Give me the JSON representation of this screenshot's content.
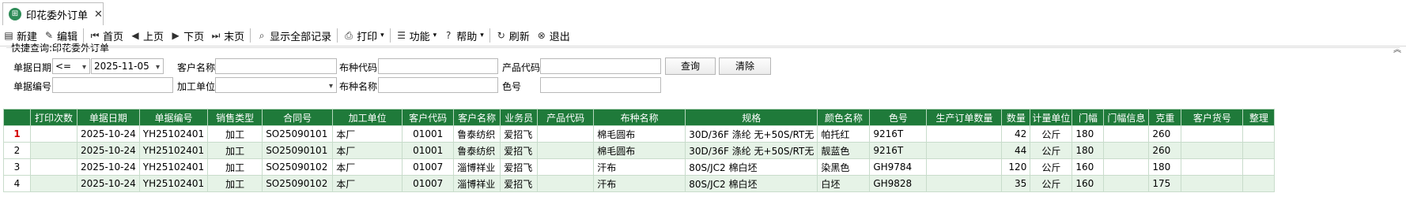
{
  "tab": {
    "label": "印花委外订单",
    "close": "✕"
  },
  "toolbar": [
    {
      "name": "new-button",
      "icon": "new-doc-icon",
      "glyph": "▤",
      "label": "新建"
    },
    {
      "name": "edit-button",
      "icon": "edit-icon",
      "glyph": "✎",
      "label": "编辑"
    },
    {
      "name": "first-page-button",
      "icon": "first-page-icon",
      "glyph": "⏮",
      "label": "首页"
    },
    {
      "name": "prev-page-button",
      "icon": "prev-page-icon",
      "glyph": "◀",
      "label": "上页"
    },
    {
      "name": "next-page-button",
      "icon": "next-page-icon",
      "glyph": "▶",
      "label": "下页"
    },
    {
      "name": "last-page-button",
      "icon": "last-page-icon",
      "glyph": "⏭",
      "label": "末页"
    },
    {
      "name": "show-all-button",
      "icon": "search-doc-icon",
      "glyph": "⌕",
      "label": "显示全部记录"
    },
    {
      "name": "print-button",
      "icon": "printer-icon",
      "glyph": "⎙",
      "label": "打印",
      "caret": "▾"
    },
    {
      "name": "function-button",
      "icon": "list-icon",
      "glyph": "☰",
      "label": "功能",
      "caret": "▾"
    },
    {
      "name": "help-button",
      "icon": "help-icon",
      "glyph": "?",
      "label": "帮助",
      "caret": "▾"
    },
    {
      "name": "refresh-button",
      "icon": "refresh-icon",
      "glyph": "↻",
      "label": "刷新"
    },
    {
      "name": "exit-button",
      "icon": "exit-icon",
      "glyph": "⊗",
      "label": "退出"
    }
  ],
  "quick": {
    "title": "快捷查询:印花委外订单",
    "date_label": "单据日期",
    "op_value": "<=",
    "date_value": "2025-11-05",
    "customer_label": "客户名称",
    "fabric_code_label": "布种代码",
    "product_code_label": "产品代码",
    "query_btn": "查询",
    "clear_btn": "清除",
    "docno_label": "单据编号",
    "unit_label": "加工单位",
    "fabric_name_label": "布种名称",
    "color_label": "色号"
  },
  "grid": {
    "columns": [
      "打印次数",
      "单据日期",
      "单据编号",
      "销售类型",
      "合同号",
      "加工单位",
      "客户代码",
      "客户名称",
      "业务员",
      "产品代码",
      "布种名称",
      "规格",
      "颜色名称",
      "色号",
      "生产订单数量",
      "数量",
      "计量单位",
      "门幅",
      "门幅信息",
      "克重",
      "客户货号",
      "整理"
    ],
    "rows": [
      {
        "no": "1",
        "cells": [
          "",
          "2025-10-24",
          "YH25102401",
          "加工",
          "SO25090101",
          "本厂",
          "01001",
          "鲁泰纺织",
          "爱招飞",
          "",
          "棉毛圆布",
          "30D/36F 涤纶 无+50S/RT无",
          "帕托红",
          "9216T",
          "",
          "42",
          "公斤",
          "180",
          "",
          "260",
          "",
          ""
        ]
      },
      {
        "no": "2",
        "cells": [
          "",
          "2025-10-24",
          "YH25102401",
          "加工",
          "SO25090101",
          "本厂",
          "01001",
          "鲁泰纺织",
          "爱招飞",
          "",
          "棉毛圆布",
          "30D/36F 涤纶 无+50S/RT无",
          "靓蓝色",
          "9216T",
          "",
          "44",
          "公斤",
          "180",
          "",
          "260",
          "",
          ""
        ]
      },
      {
        "no": "3",
        "cells": [
          "",
          "2025-10-24",
          "YH25102401",
          "加工",
          "SO25090102",
          "本厂",
          "01007",
          "淄博祥业",
          "爱招飞",
          "",
          "汗布",
          "80S/JC2 棉白坯",
          "染黑色",
          "GH9784",
          "",
          "120",
          "公斤",
          "160",
          "",
          "180",
          "",
          ""
        ]
      },
      {
        "no": "4",
        "cells": [
          "",
          "2025-10-24",
          "YH25102401",
          "加工",
          "SO25090102",
          "本厂",
          "01007",
          "淄博祥业",
          "爱招飞",
          "",
          "汗布",
          "80S/JC2 棉白坯",
          "白坯",
          "GH9828",
          "",
          "35",
          "公斤",
          "160",
          "",
          "175",
          "",
          ""
        ]
      }
    ]
  }
}
